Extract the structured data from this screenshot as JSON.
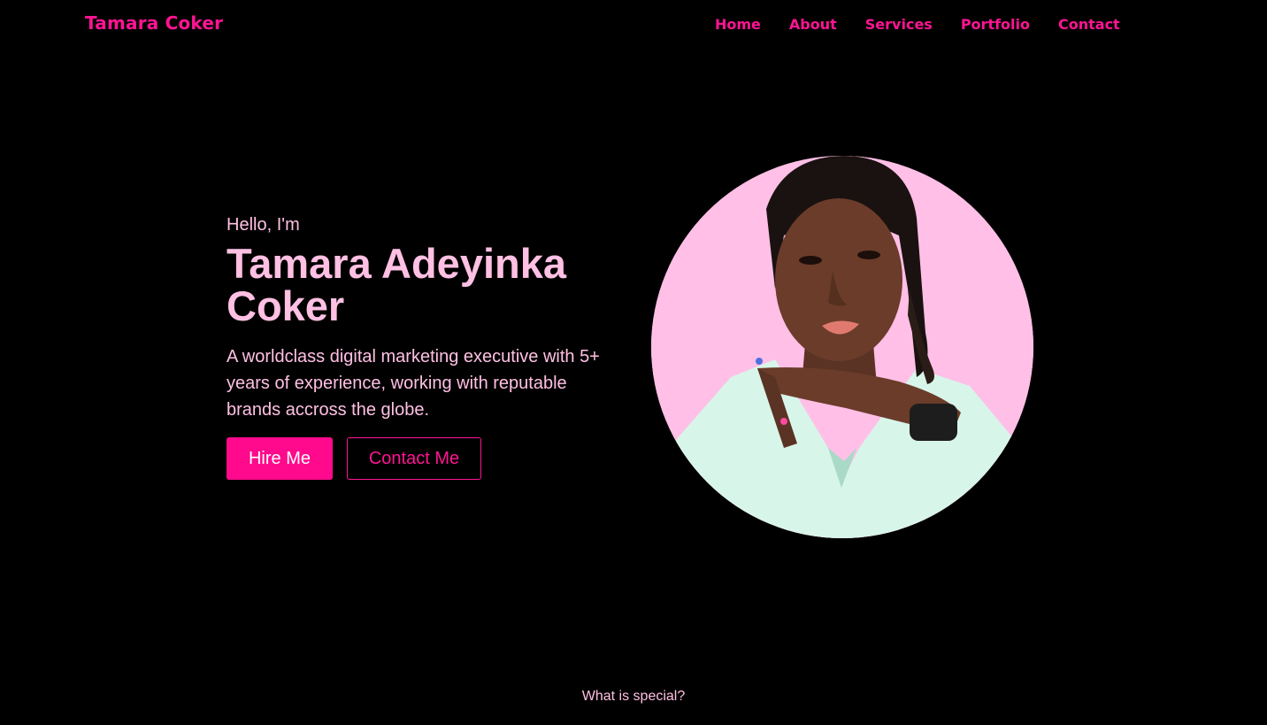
{
  "header": {
    "brand": "Tamara Coker",
    "nav": [
      "Home",
      "About",
      "Services",
      "Portfolio",
      "Contact"
    ]
  },
  "hero": {
    "greeting": "Hello, I'm",
    "name": "Tamara Adeyinka Coker",
    "description": "A worldclass digital marketing executive with 5+ years of experience, working with reputable brands accross the globe.",
    "hire_button": "Hire Me",
    "contact_button": "Contact Me"
  },
  "next_section": {
    "title": "What is special?"
  },
  "colors": {
    "background": "#000000",
    "accent": "#ff1493",
    "primary_button": "#ff0a8c",
    "text_pink": "#ffc0e3",
    "avatar_bg": "#ffbfe6"
  }
}
